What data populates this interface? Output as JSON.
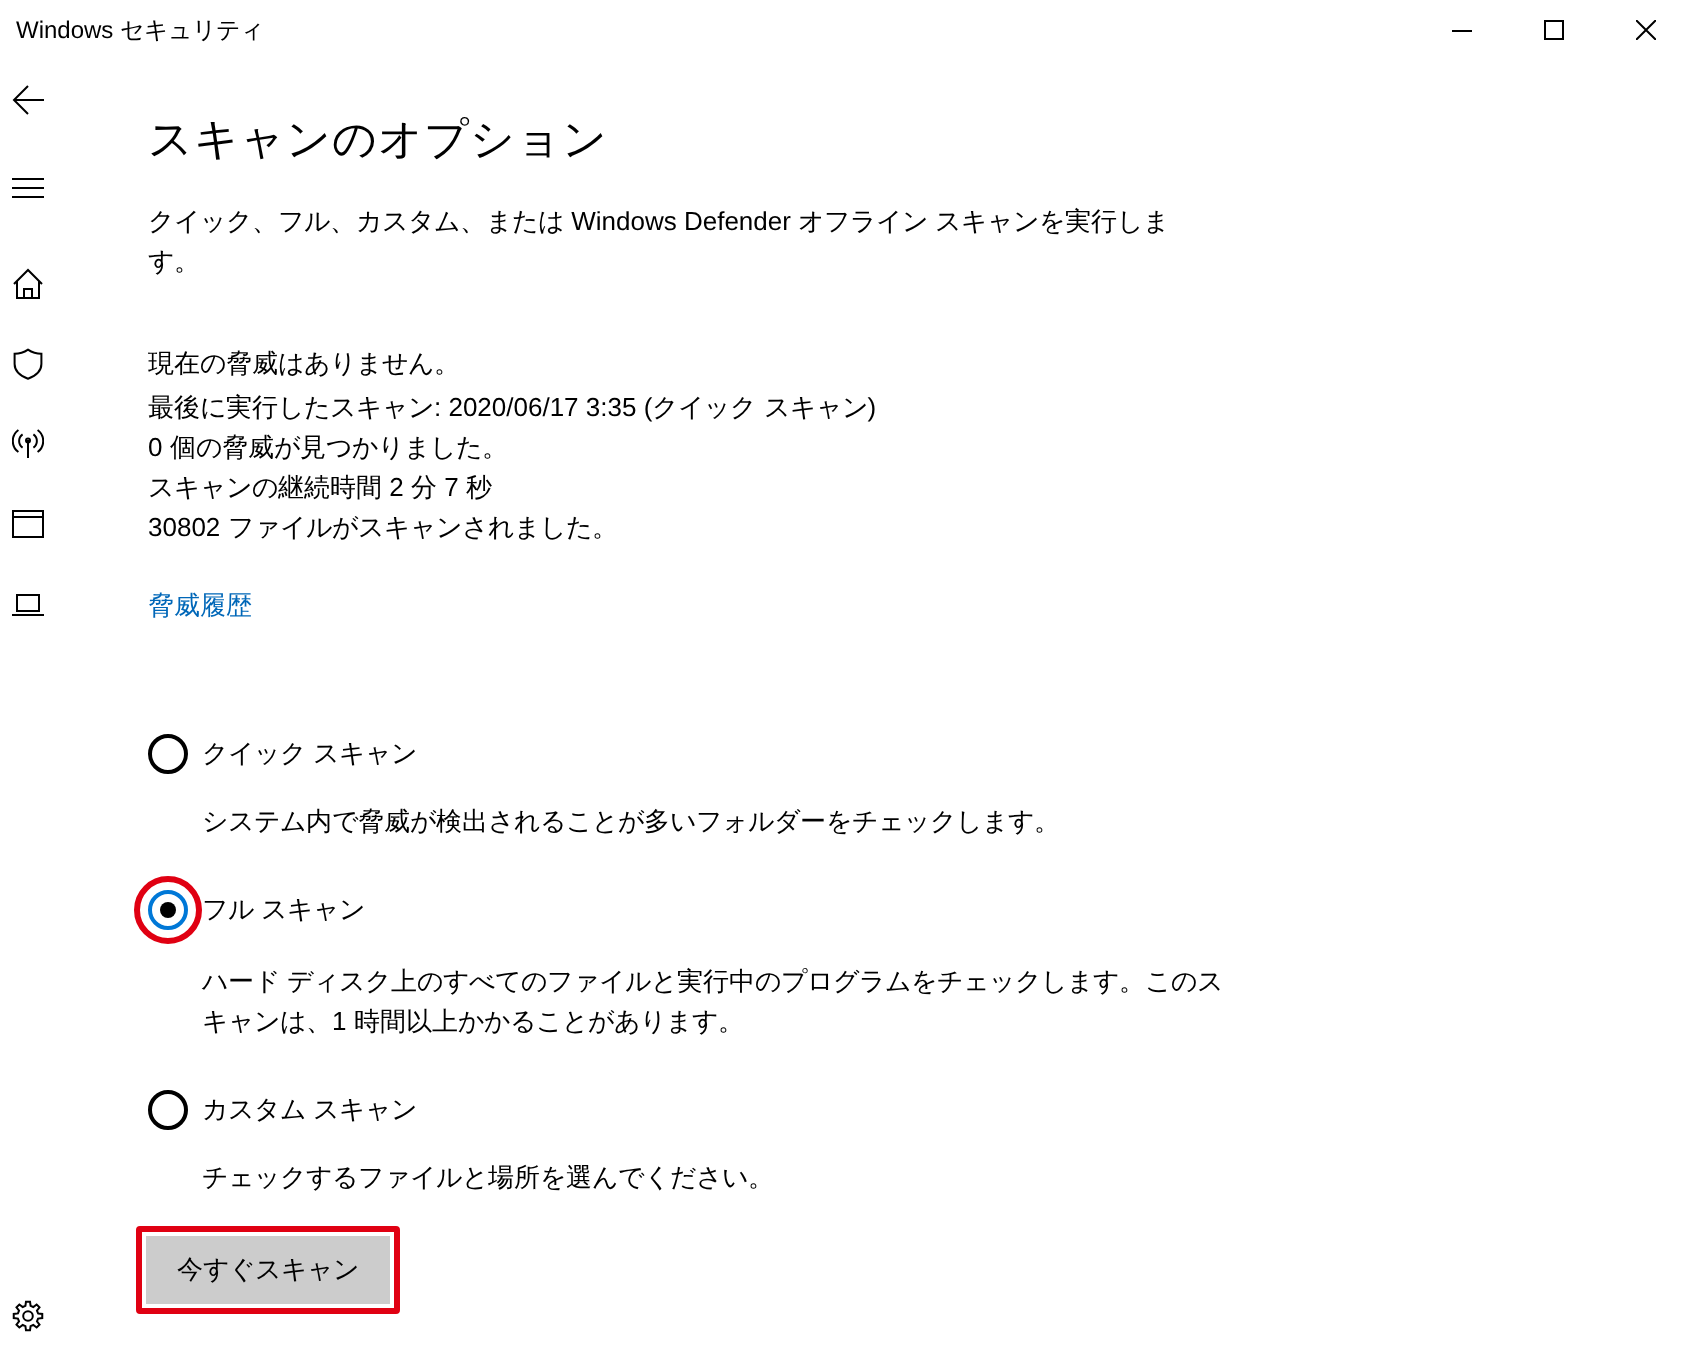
{
  "window": {
    "title": "Windows セキュリティ"
  },
  "page": {
    "title": "スキャンのオプション",
    "description": "クイック、フル、カスタム、または Windows Defender オフライン スキャンを実行します。",
    "status_lines": [
      "現在の脅威はありません。",
      "最後に実行したスキャン: 2020/06/17 3:35 (クイック スキャン)",
      "0 個の脅威が見つかりました。",
      "スキャンの継続時間 2 分 7 秒",
      "30802 ファイルがスキャンされました。"
    ],
    "history_link": "脅威履歴"
  },
  "scan_options": [
    {
      "label": "クイック スキャン",
      "description": "システム内で脅威が検出されることが多いフォルダーをチェックします。",
      "selected": false,
      "highlighted": false
    },
    {
      "label": "フル スキャン",
      "description": "ハード ディスク上のすべてのファイルと実行中のプログラムをチェックします。このスキャンは、1 時間以上かかることがあります。",
      "selected": true,
      "highlighted": true
    },
    {
      "label": "カスタム スキャン",
      "description": "チェックするファイルと場所を選んでください。",
      "selected": false,
      "highlighted": false
    }
  ],
  "scan_button": {
    "label": "今すぐスキャン",
    "highlighted": true
  }
}
